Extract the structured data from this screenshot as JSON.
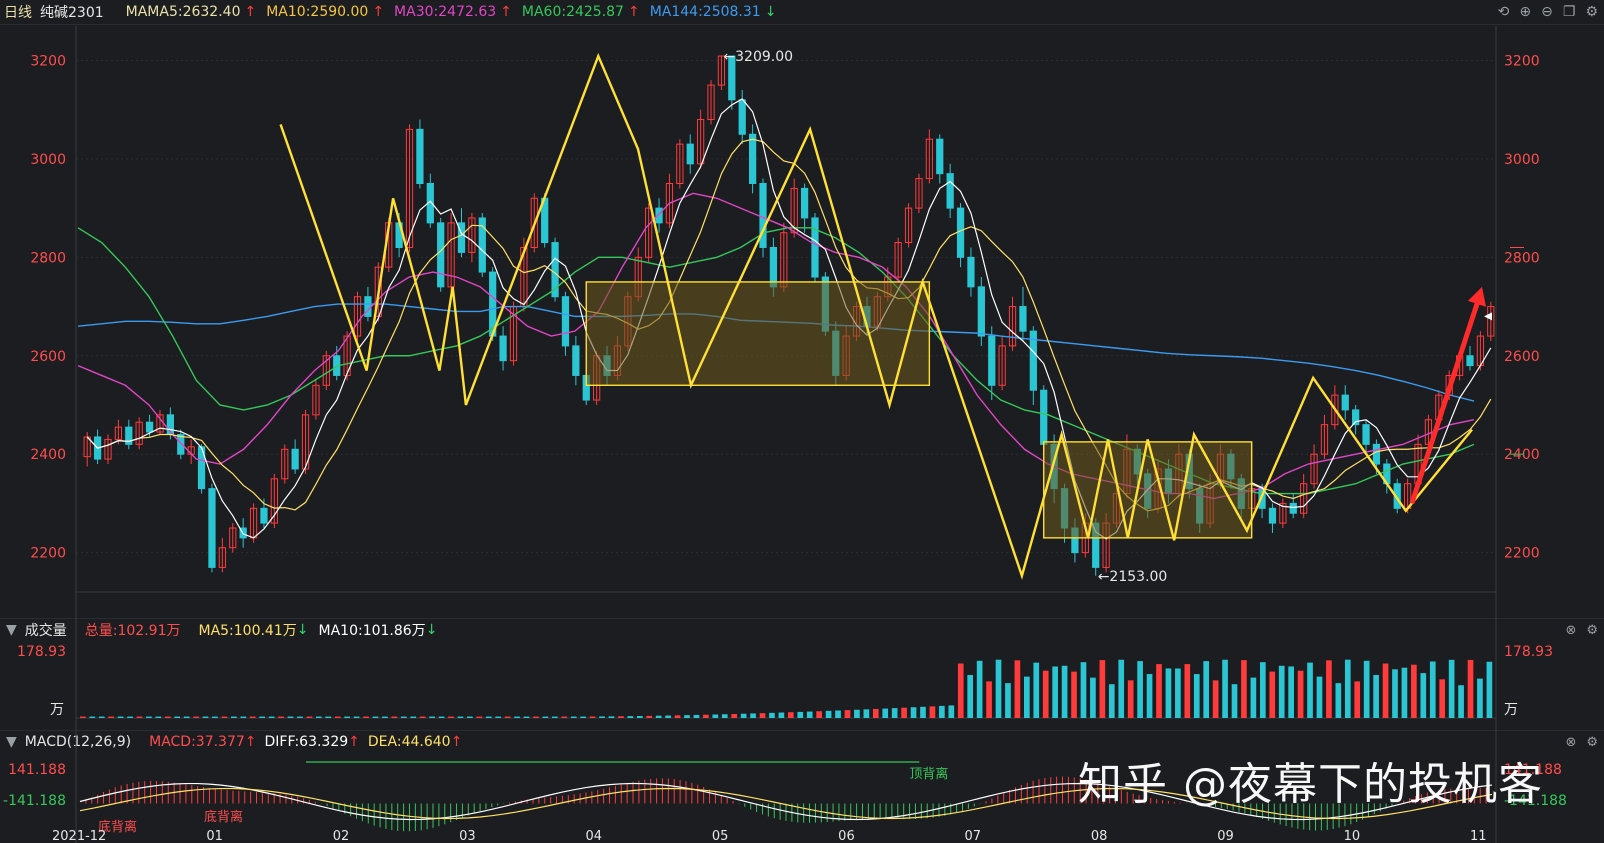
{
  "header": {
    "period": "日线",
    "symbol": "纯碱2301",
    "ma_label": "MA",
    "ma_items": [
      {
        "label": "MA5:2632.40",
        "arrow": "↑",
        "color": "#e9e1a8",
        "arrow_color": "#ff3b3b"
      },
      {
        "label": "MA10:2590.00",
        "arrow": "↑",
        "color": "#f3c542",
        "arrow_color": "#ff3b3b"
      },
      {
        "label": "MA30:2472.63",
        "arrow": "↑",
        "color": "#e046c6",
        "arrow_color": "#ff3b3b"
      },
      {
        "label": "MA60:2425.87",
        "arrow": "↑",
        "color": "#35c75a",
        "arrow_color": "#ff3b3b"
      },
      {
        "label": "MA144:2508.31",
        "arrow": "↓",
        "color": "#3c9bf0",
        "arrow_color": "#2fd36b"
      }
    ],
    "icons": [
      "undo-icon",
      "zoom-in-icon",
      "zoom-out-icon",
      "window-icon",
      "settings-icon"
    ]
  },
  "volume_header": {
    "title": "成交量",
    "total": "总量:102.91万",
    "ma5": "MA5:100.41万",
    "ma5_arrow": "↓",
    "ma10": "MA10:101.86万",
    "ma10_arrow": "↓"
  },
  "macd_header": {
    "title": "MACD(12,26,9)",
    "macd": "MACD:37.377",
    "diff": "DIFF:63.329",
    "dea": "DEA:44.640",
    "arrow": "↑"
  },
  "watermark": "知乎 @夜幕下的投机客",
  "colors": {
    "up": "#ff3b3b",
    "down": "#2bc6d4",
    "zigzag": "#ffe033",
    "box_fill": "#6e5a1c",
    "axis_text": "#ff4d4d",
    "ma5": "#ffffff",
    "ma10": "#ffe066",
    "ma30": "#e046c6",
    "ma60": "#35c75a",
    "ma144": "#3c9bf0"
  },
  "chart_data": {
    "type": "candlestick",
    "price_axis": {
      "ticks": [
        2200,
        2400,
        2600,
        2800,
        3000,
        3200
      ],
      "ylim": [
        2120,
        3270
      ]
    },
    "x_months": [
      "2021-12",
      "01",
      "02",
      "03",
      "04",
      "05",
      "06",
      "07",
      "08",
      "09",
      "10",
      "11"
    ],
    "annotations": [
      {
        "text": "←3209.00",
        "price": 3209
      },
      {
        "text": "←2153.00",
        "price": 2153
      }
    ],
    "candles": [
      [
        2395,
        2435,
        2375,
        2445
      ],
      [
        2435,
        2390,
        2380,
        2450
      ],
      [
        2390,
        2430,
        2380,
        2440
      ],
      [
        2430,
        2455,
        2420,
        2470
      ],
      [
        2455,
        2420,
        2410,
        2470
      ],
      [
        2420,
        2465,
        2410,
        2475
      ],
      [
        2465,
        2445,
        2435,
        2480
      ],
      [
        2445,
        2480,
        2440,
        2490
      ],
      [
        2480,
        2440,
        2430,
        2495
      ],
      [
        2440,
        2400,
        2390,
        2450
      ],
      [
        2400,
        2415,
        2380,
        2430
      ],
      [
        2415,
        2330,
        2320,
        2420
      ],
      [
        2330,
        2170,
        2160,
        2340
      ],
      [
        2170,
        2210,
        2160,
        2230
      ],
      [
        2210,
        2250,
        2200,
        2260
      ],
      [
        2250,
        2230,
        2210,
        2270
      ],
      [
        2230,
        2290,
        2220,
        2300
      ],
      [
        2290,
        2260,
        2250,
        2310
      ],
      [
        2260,
        2350,
        2250,
        2360
      ],
      [
        2350,
        2410,
        2340,
        2420
      ],
      [
        2410,
        2370,
        2360,
        2430
      ],
      [
        2370,
        2480,
        2360,
        2490
      ],
      [
        2480,
        2540,
        2470,
        2550
      ],
      [
        2540,
        2600,
        2530,
        2610
      ],
      [
        2600,
        2560,
        2550,
        2620
      ],
      [
        2560,
        2640,
        2550,
        2650
      ],
      [
        2640,
        2720,
        2630,
        2730
      ],
      [
        2720,
        2680,
        2670,
        2740
      ],
      [
        2680,
        2780,
        2670,
        2790
      ],
      [
        2780,
        2870,
        2770,
        2880
      ],
      [
        2870,
        2820,
        2800,
        2890
      ],
      [
        2820,
        3060,
        2810,
        3070
      ],
      [
        3060,
        2950,
        2940,
        3080
      ],
      [
        2950,
        2870,
        2860,
        2970
      ],
      [
        2870,
        2740,
        2730,
        2880
      ],
      [
        2740,
        2870,
        2730,
        2890
      ],
      [
        2870,
        2810,
        2800,
        2900
      ],
      [
        2810,
        2880,
        2790,
        2890
      ],
      [
        2880,
        2770,
        2760,
        2890
      ],
      [
        2770,
        2640,
        2630,
        2780
      ],
      [
        2640,
        2590,
        2570,
        2660
      ],
      [
        2590,
        2700,
        2580,
        2710
      ],
      [
        2700,
        2820,
        2690,
        2840
      ],
      [
        2820,
        2920,
        2810,
        2930
      ],
      [
        2920,
        2830,
        2820,
        2930
      ],
      [
        2830,
        2720,
        2710,
        2840
      ],
      [
        2720,
        2620,
        2600,
        2730
      ],
      [
        2620,
        2560,
        2540,
        2640
      ],
      [
        2560,
        2510,
        2500,
        2580
      ],
      [
        2510,
        2600,
        2500,
        2610
      ],
      [
        2600,
        2560,
        2540,
        2620
      ],
      [
        2560,
        2620,
        2550,
        2640
      ],
      [
        2620,
        2720,
        2610,
        2730
      ],
      [
        2720,
        2800,
        2710,
        2820
      ],
      [
        2800,
        2900,
        2790,
        2910
      ],
      [
        2900,
        2870,
        2850,
        2920
      ],
      [
        2870,
        2950,
        2860,
        2970
      ],
      [
        2950,
        3030,
        2940,
        3040
      ],
      [
        3030,
        2990,
        2970,
        3050
      ],
      [
        2990,
        3080,
        2980,
        3100
      ],
      [
        3080,
        3150,
        3070,
        3160
      ],
      [
        3150,
        3209,
        3140,
        3209
      ],
      [
        3209,
        3120,
        3100,
        3209
      ],
      [
        3120,
        3050,
        3030,
        3140
      ],
      [
        3050,
        2950,
        2930,
        3070
      ],
      [
        2950,
        2820,
        2800,
        2960
      ],
      [
        2820,
        2740,
        2720,
        2840
      ],
      [
        2740,
        2850,
        2730,
        2870
      ],
      [
        2850,
        2940,
        2840,
        2960
      ],
      [
        2940,
        2880,
        2850,
        2950
      ],
      [
        2880,
        2760,
        2750,
        2890
      ],
      [
        2760,
        2650,
        2640,
        2770
      ],
      [
        2650,
        2560,
        2540,
        2670
      ],
      [
        2560,
        2640,
        2550,
        2660
      ],
      [
        2640,
        2700,
        2630,
        2710
      ],
      [
        2700,
        2660,
        2640,
        2720
      ],
      [
        2660,
        2720,
        2650,
        2730
      ],
      [
        2720,
        2760,
        2710,
        2780
      ],
      [
        2760,
        2830,
        2750,
        2840
      ],
      [
        2830,
        2900,
        2820,
        2910
      ],
      [
        2900,
        2960,
        2890,
        2970
      ],
      [
        2960,
        3040,
        2950,
        3060
      ],
      [
        3040,
        2970,
        2950,
        3050
      ],
      [
        2970,
        2900,
        2880,
        2990
      ],
      [
        2900,
        2800,
        2780,
        2910
      ],
      [
        2800,
        2740,
        2720,
        2820
      ],
      [
        2740,
        2640,
        2620,
        2760
      ],
      [
        2640,
        2540,
        2510,
        2660
      ],
      [
        2540,
        2620,
        2530,
        2640
      ],
      [
        2620,
        2700,
        2610,
        2720
      ],
      [
        2700,
        2650,
        2630,
        2740
      ],
      [
        2650,
        2530,
        2500,
        2660
      ],
      [
        2530,
        2420,
        2400,
        2540
      ],
      [
        2420,
        2330,
        2300,
        2440
      ],
      [
        2330,
        2250,
        2220,
        2340
      ],
      [
        2250,
        2200,
        2180,
        2270
      ],
      [
        2200,
        2260,
        2190,
        2280
      ],
      [
        2260,
        2170,
        2153,
        2270
      ],
      [
        2170,
        2260,
        2160,
        2280
      ],
      [
        2260,
        2320,
        2250,
        2340
      ],
      [
        2320,
        2410,
        2310,
        2440
      ],
      [
        2410,
        2360,
        2340,
        2420
      ],
      [
        2360,
        2290,
        2270,
        2370
      ],
      [
        2290,
        2370,
        2280,
        2390
      ],
      [
        2370,
        2320,
        2300,
        2390
      ],
      [
        2320,
        2400,
        2310,
        2420
      ],
      [
        2400,
        2330,
        2310,
        2410
      ],
      [
        2330,
        2260,
        2240,
        2340
      ],
      [
        2260,
        2340,
        2250,
        2360
      ],
      [
        2340,
        2400,
        2330,
        2420
      ],
      [
        2400,
        2350,
        2330,
        2410
      ],
      [
        2350,
        2290,
        2270,
        2360
      ],
      [
        2290,
        2330,
        2280,
        2350
      ],
      [
        2330,
        2290,
        2270,
        2340
      ],
      [
        2290,
        2260,
        2240,
        2300
      ],
      [
        2260,
        2300,
        2250,
        2310
      ],
      [
        2300,
        2280,
        2270,
        2320
      ],
      [
        2280,
        2340,
        2270,
        2360
      ],
      [
        2340,
        2400,
        2330,
        2420
      ],
      [
        2400,
        2460,
        2390,
        2480
      ],
      [
        2460,
        2520,
        2450,
        2540
      ],
      [
        2520,
        2490,
        2470,
        2540
      ],
      [
        2490,
        2460,
        2440,
        2500
      ],
      [
        2460,
        2420,
        2400,
        2470
      ],
      [
        2420,
        2380,
        2360,
        2430
      ],
      [
        2380,
        2340,
        2320,
        2390
      ],
      [
        2340,
        2290,
        2280,
        2350
      ],
      [
        2290,
        2340,
        2280,
        2350
      ],
      [
        2340,
        2420,
        2330,
        2440
      ],
      [
        2420,
        2470,
        2410,
        2480
      ],
      [
        2470,
        2520,
        2460,
        2530
      ],
      [
        2520,
        2560,
        2510,
        2570
      ],
      [
        2560,
        2600,
        2550,
        2610
      ],
      [
        2600,
        2580,
        2570,
        2620
      ],
      [
        2580,
        2640,
        2570,
        2650
      ],
      [
        2640,
        2700,
        2630,
        2710
      ]
    ],
    "ma": {
      "ma30": [
        2580,
        2560,
        2540,
        2500,
        2440,
        2390,
        2380,
        2410,
        2460,
        2520,
        2570,
        2610,
        2680,
        2730,
        2760,
        2770,
        2760,
        2740,
        2700,
        2660,
        2640,
        2650,
        2690,
        2780,
        2860,
        2910,
        2930,
        2920,
        2900,
        2880,
        2860,
        2830,
        2810,
        2800,
        2780,
        2740,
        2680,
        2600,
        2520,
        2460,
        2410,
        2380,
        2360,
        2350,
        2340,
        2330,
        2320,
        2320,
        2310,
        2320,
        2330,
        2360,
        2380,
        2390,
        2400,
        2410,
        2420,
        2440,
        2460,
        2470
      ],
      "ma60": [
        2860,
        2830,
        2780,
        2720,
        2640,
        2550,
        2500,
        2490,
        2500,
        2520,
        2550,
        2580,
        2590,
        2600,
        2600,
        2610,
        2620,
        2640,
        2670,
        2700,
        2730,
        2770,
        2800,
        2800,
        2790,
        2780,
        2790,
        2800,
        2820,
        2850,
        2860,
        2860,
        2840,
        2810,
        2770,
        2720,
        2660,
        2600,
        2550,
        2510,
        2490,
        2480,
        2460,
        2440,
        2420,
        2400,
        2380,
        2360,
        2340,
        2330,
        2320,
        2320,
        2320,
        2330,
        2340,
        2360,
        2380,
        2390,
        2400,
        2420
      ],
      "ma144": [
        2660,
        2665,
        2670,
        2670,
        2668,
        2665,
        2665,
        2672,
        2680,
        2690,
        2700,
        2705,
        2705,
        2705,
        2700,
        2695,
        2690,
        2690,
        2700,
        2700,
        2690,
        2680,
        2680,
        2680,
        2682,
        2685,
        2685,
        2680,
        2672,
        2670,
        2668,
        2666,
        2662,
        2660,
        2656,
        2652,
        2650,
        2648,
        2646,
        2640,
        2635,
        2630,
        2625,
        2620,
        2615,
        2610,
        2605,
        2602,
        2600,
        2598,
        2595,
        2590,
        2585,
        2578,
        2570,
        2560,
        2548,
        2535,
        2520,
        2508
      ]
    },
    "volume_axis": {
      "top": "178.93",
      "unit": "万"
    },
    "macd_axis": {
      "top": "141.188",
      "bottom": "-141.188"
    },
    "macd_labels": [
      {
        "text": "底背离",
        "color": "#ff4d4d"
      },
      {
        "text": "底背离",
        "color": "#ff4d4d"
      },
      {
        "text": "顶背离",
        "color": "#35c75a"
      }
    ]
  }
}
